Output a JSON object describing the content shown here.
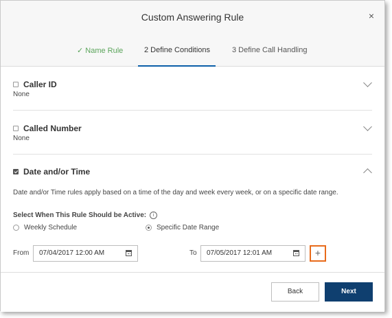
{
  "dialog": {
    "title": "Custom Answering Rule",
    "close_glyph": "×"
  },
  "steps": [
    {
      "label": "✓ Name Rule",
      "state": "done"
    },
    {
      "label": "2  Define Conditions",
      "state": "active"
    },
    {
      "label": "3  Define Call Handling",
      "state": "pending"
    }
  ],
  "sections": {
    "caller_id": {
      "title": "Caller ID",
      "checked": false,
      "value": "None"
    },
    "called_number": {
      "title": "Called Number",
      "checked": false,
      "value": "None"
    },
    "date_time": {
      "title": "Date and/or Time",
      "checked": true,
      "description": "Date and/or Time rules apply based on a time of the day and week every week, or on a specific date range.",
      "select_label": "Select When This Rule Should be Active:",
      "info_glyph": "i",
      "options": [
        {
          "label": "Weekly Schedule",
          "selected": false
        },
        {
          "label": "Specific Date Range",
          "selected": true
        }
      ],
      "from_label": "From",
      "from_value": "07/04/2017 12:00 AM",
      "to_label": "To",
      "to_value": "07/05/2017 12:01 AM",
      "add_glyph": "+"
    }
  },
  "footer": {
    "back_label": "Back",
    "next_label": "Next"
  },
  "colors": {
    "accent": "#0a5ea8",
    "next_button": "#0f3f6f",
    "done_step": "#5aa45a",
    "highlight": "#e86a1a"
  }
}
